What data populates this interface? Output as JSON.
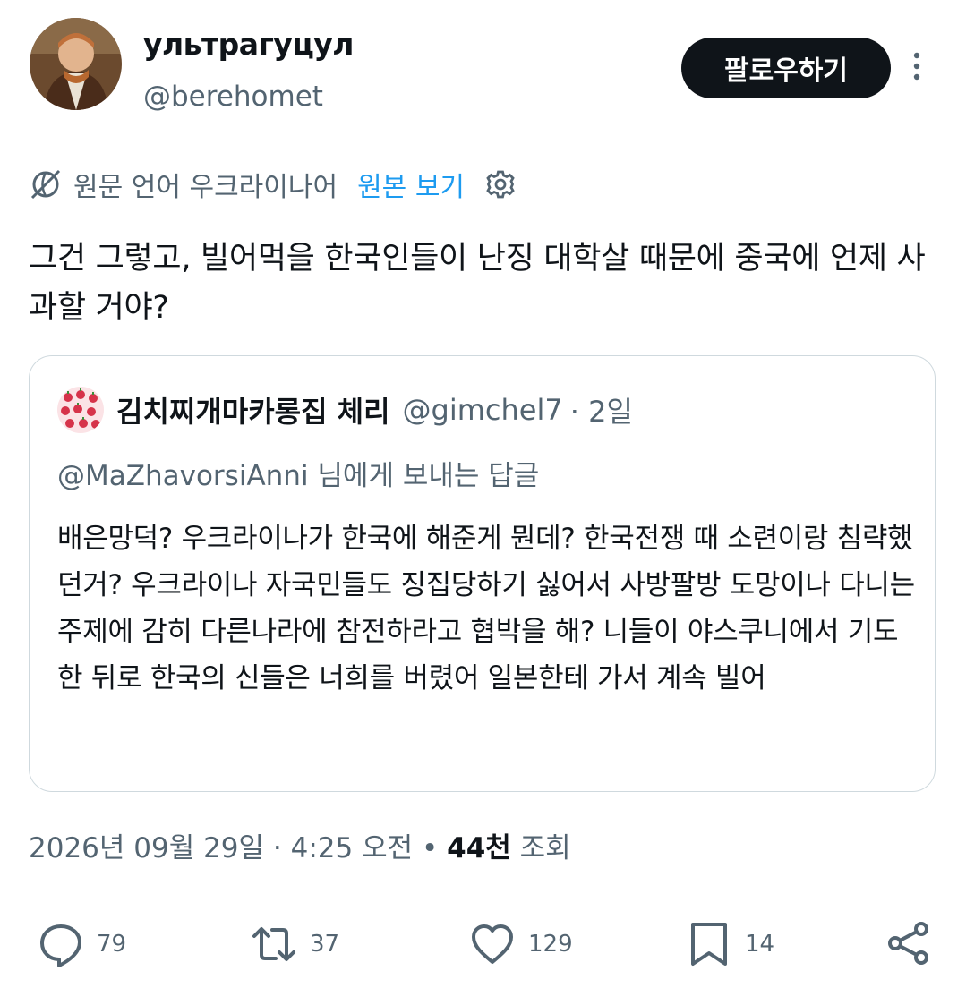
{
  "header": {
    "display_name": "ультрагуцул",
    "handle": "@berehomet",
    "follow_label": "팔로우하기"
  },
  "translation": {
    "source_language": "원문 언어 우크라이나어",
    "view_original": "원본 보기"
  },
  "tweet": {
    "text": "그건 그렇고, 빌어먹을 한국인들이 난징 대학살 때문에 중국에 언제 사과할 거야?"
  },
  "quote": {
    "display_name": "김치찌개마카롱집 체리",
    "handle": "@gimchel7",
    "time": "· 2일",
    "reply_to": "@MaZhavorsiAnni 님에게 보내는 답글",
    "text": "배은망덕? 우크라이나가 한국에 해준게 뭔데? 한국전쟁 때 소련이랑 침략했던거? 우크라이나 자국민들도 징집당하기 싫어서 사방팔방 도망이나 다니는 주제에 감히 다른나라에 참전하라고 협박을 해? 니들이 야스쿠니에서 기도한 뒤로 한국의 신들은 너희를 버렸어 일본한테 가서 계속 빌어"
  },
  "meta": {
    "datetime": "2026년 09월 29일 · 4:25 오전 •",
    "views_count": "44천",
    "views_label": "조회"
  },
  "actions": {
    "replies": "79",
    "reposts": "37",
    "likes": "129",
    "bookmarks": "14"
  },
  "colors": {
    "text": "#0f1419",
    "secondary": "#536471",
    "link": "#1d9bf0",
    "border": "#cfd9de"
  },
  "icons": [
    "globe-slash-icon",
    "gear-icon",
    "more-vertical-icon",
    "reply-icon",
    "repost-icon",
    "like-icon",
    "bookmark-icon",
    "share-icon"
  ]
}
